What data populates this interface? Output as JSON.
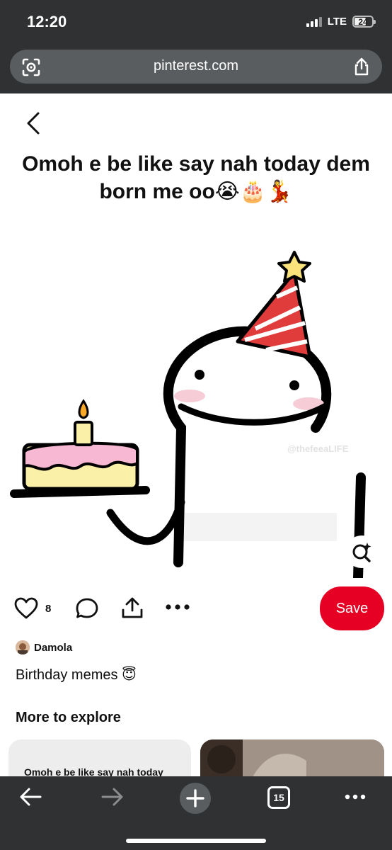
{
  "status_bar": {
    "time": "12:20",
    "network": "LTE",
    "battery": "24"
  },
  "browser": {
    "url": "pinterest.com"
  },
  "pin": {
    "image_caption": "Omoh e be like say nah today dem born me oo😭🎂💃",
    "image_watermark": "@thefeeaLIFE",
    "like_count": "8",
    "save_label": "Save",
    "author": "Damola",
    "title": "Birthday memes 😇"
  },
  "explore": {
    "heading": "More to explore",
    "card_left_caption": "Omoh e be like say nah today"
  },
  "bottom_nav": {
    "tab_count": "15"
  },
  "colors": {
    "save_red": "#e60023",
    "chrome_dark": "#2f3132",
    "urlbar": "#5a5d5f"
  },
  "icons": {
    "lens": "visual-search-icon",
    "share": "share-icon",
    "like": "heart-icon",
    "comment": "comment-icon",
    "more": "more-icon",
    "back": "back-arrow-icon",
    "forward": "forward-arrow-icon",
    "plus": "plus-icon",
    "tabs": "tabs-icon"
  }
}
